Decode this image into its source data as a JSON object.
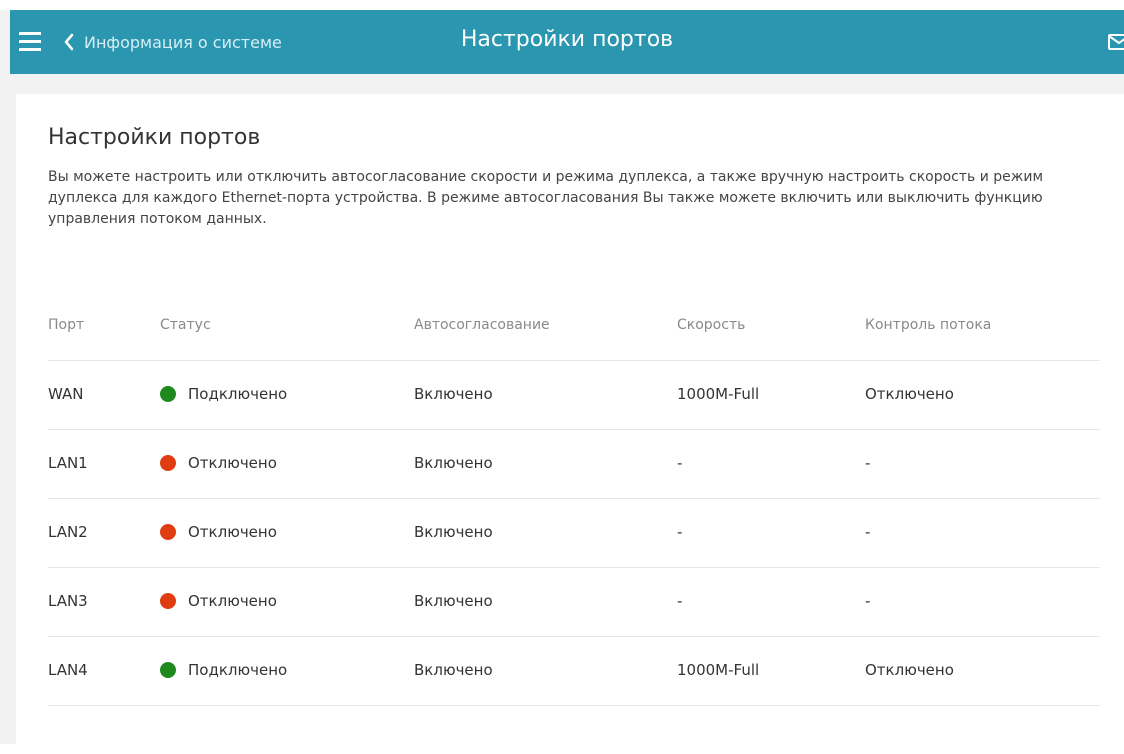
{
  "header": {
    "back_label": "Информация о системе",
    "title": "Настройки портов",
    "background_color": "#2a96b0",
    "menu_icon": "hamburger-menu-icon",
    "back_icon": "chevron-left-icon",
    "mail_icon": "envelope-icon"
  },
  "page": {
    "title": "Настройки портов",
    "description": "Вы можете настроить или отключить автосогласование скорости и режима дуплекса, а также вручную настроить скорость и режим дуплекса для каждого Ethernet-порта устройства. В режиме автосогласования Вы также можете включить или выключить функцию управления потоком данных."
  },
  "table": {
    "columns": [
      "Порт",
      "Статус",
      "Автосогласование",
      "Скорость",
      "Контроль потока"
    ],
    "status_colors": {
      "connected": "#1e8a1e",
      "disconnected": "#e03c12"
    },
    "rows": [
      {
        "port": "WAN",
        "status": "Подключено",
        "state": "connected",
        "autoneg": "Включено",
        "speed": "1000M-Full",
        "flow": "Отключено"
      },
      {
        "port": "LAN1",
        "status": "Отключено",
        "state": "disconnected",
        "autoneg": "Включено",
        "speed": "-",
        "flow": "-"
      },
      {
        "port": "LAN2",
        "status": "Отключено",
        "state": "disconnected",
        "autoneg": "Включено",
        "speed": "-",
        "flow": "-"
      },
      {
        "port": "LAN3",
        "status": "Отключено",
        "state": "disconnected",
        "autoneg": "Включено",
        "speed": "-",
        "flow": "-"
      },
      {
        "port": "LAN4",
        "status": "Подключено",
        "state": "connected",
        "autoneg": "Включено",
        "speed": "1000M-Full",
        "flow": "Отключено"
      }
    ]
  }
}
